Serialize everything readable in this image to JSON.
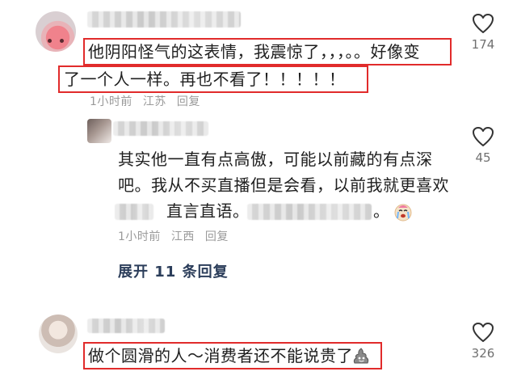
{
  "comments": [
    {
      "text_line1": "他阴阳怪气的这表情，我震惊了，，，。。好像变",
      "text_line2": "了一个人一样。再也不看了！！！！！",
      "time": "1小时前",
      "location": "江苏",
      "reply_label": "回复",
      "likes": "174"
    },
    {
      "text_line1": "其实他一直有点高傲，可能以前藏的有点深",
      "text_line2": "吧。我从不买直播但是会看，以前我就更喜欢",
      "text_line3_mid": "直言直语。",
      "text_line3_end": "。",
      "time": "1小时前",
      "location": "江西",
      "reply_label": "回复",
      "likes": "45"
    },
    {
      "text": "做个圆滑的人～消费者还不能说贵了",
      "likes": "326"
    }
  ],
  "expand_replies": "展开 11 条回复",
  "icons": {
    "like": "heart-outline-icon",
    "emoji_crying": "crying-face-icon",
    "emoji_poop": "poop-icon"
  },
  "colors": {
    "highlight_box": "#e12b2b",
    "expand_link": "#2b3d5a",
    "meta_text": "#9a9a9a"
  }
}
